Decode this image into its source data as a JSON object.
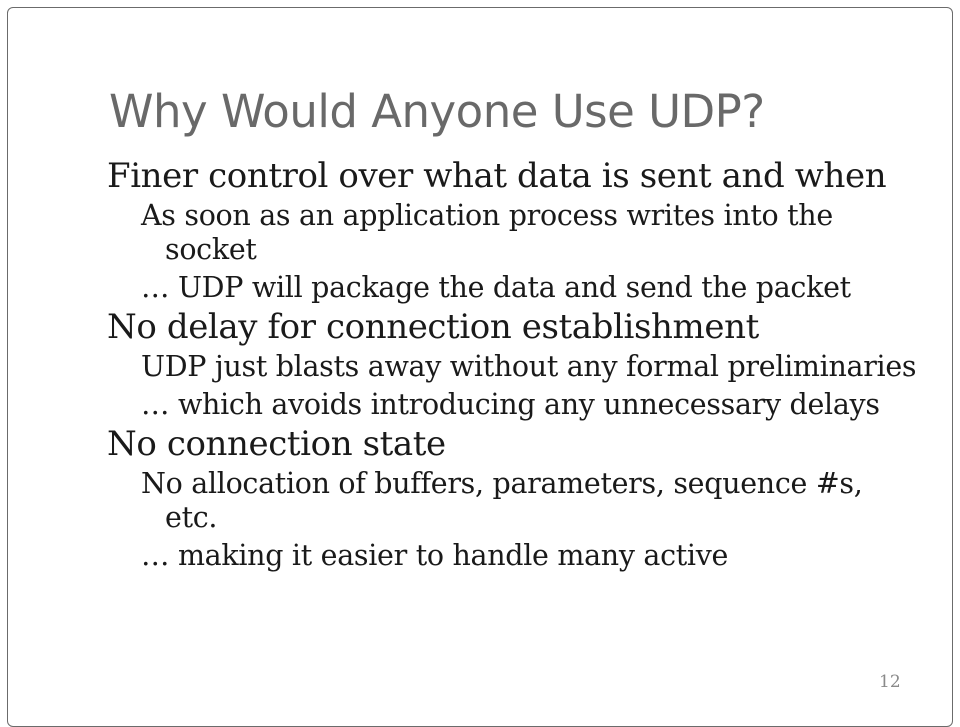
{
  "slide": {
    "title": "Why Would Anyone Use UDP?",
    "page_number": "12",
    "bullets": [
      {
        "level": 1,
        "text": "Finer control over what data is sent and when"
      },
      {
        "level": 2,
        "text": "As soon as an application process writes into the socket"
      },
      {
        "level": 2,
        "text": "… UDP will package the data and send the packet"
      },
      {
        "level": 1,
        "text": "No delay for connection establishment"
      },
      {
        "level": 2,
        "text": "UDP just blasts away without any formal preliminaries"
      },
      {
        "level": 2,
        "text": "… which avoids introducing any unnecessary delays"
      },
      {
        "level": 1,
        "text": "No connection state"
      },
      {
        "level": 2,
        "text": "No allocation of buffers, parameters, sequence #s, etc."
      },
      {
        "level": 2,
        "text": "… making it easier to handle many active"
      }
    ]
  }
}
